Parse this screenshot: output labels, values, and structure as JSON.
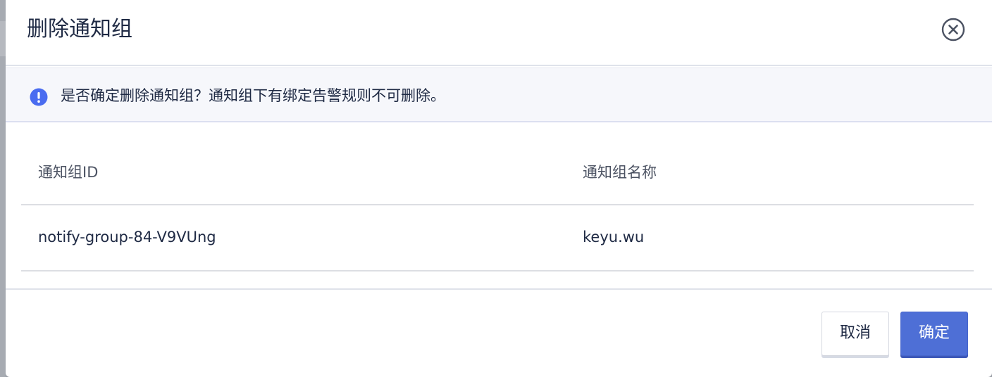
{
  "dialog": {
    "title": "删除通知组",
    "close_icon": "close-circle-icon"
  },
  "alert": {
    "icon": "exclamation-circle-icon",
    "message": "是否确定删除通知组？通知组下有绑定告警规则不可删除。"
  },
  "table": {
    "columns": [
      "通知组ID",
      "通知组名称"
    ],
    "rows": [
      [
        "notify-group-84-V9VUng",
        "keyu.wu"
      ]
    ]
  },
  "footer": {
    "cancel_label": "取消",
    "confirm_label": "确定"
  },
  "colors": {
    "primary": "#4e6fd6",
    "alert_icon": "#4a6cf0",
    "title_text": "#1f2a44"
  }
}
